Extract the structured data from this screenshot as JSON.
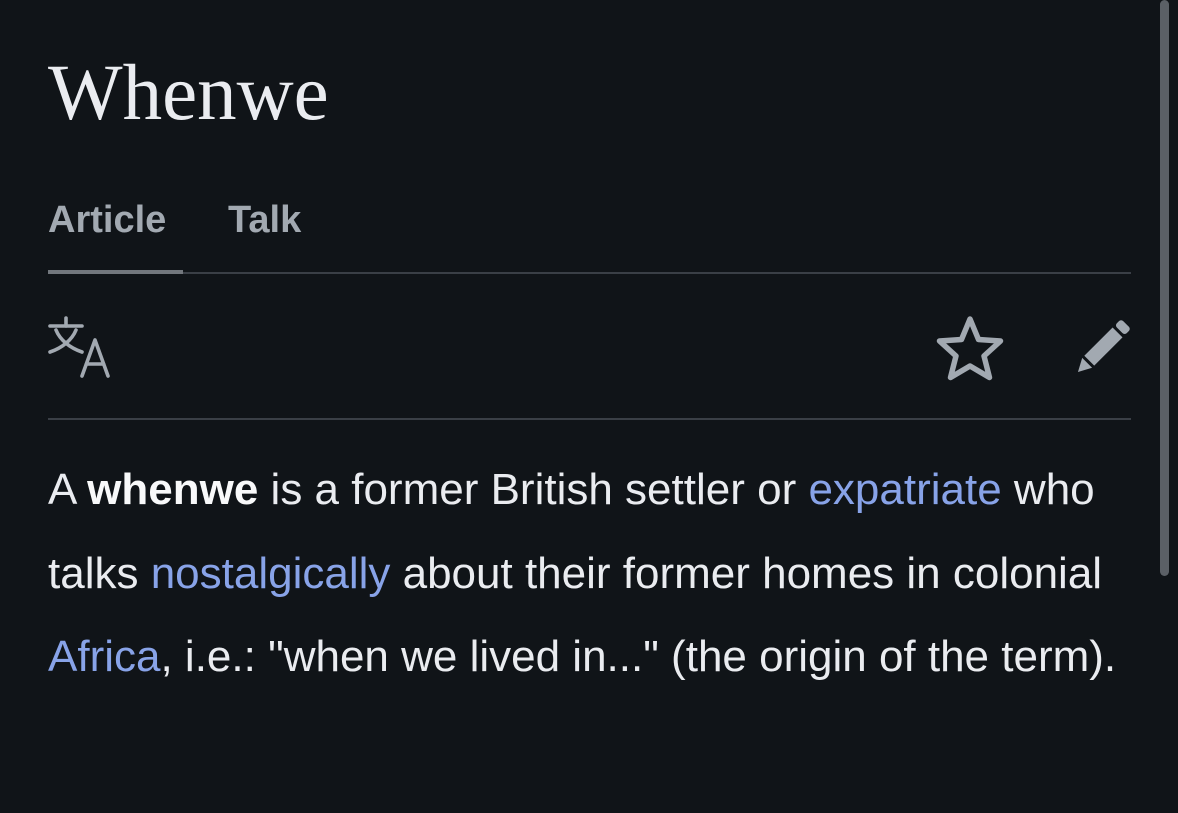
{
  "article": {
    "title": "Whenwe",
    "tabs": [
      {
        "label": "Article",
        "active": true
      },
      {
        "label": "Talk",
        "active": false
      }
    ],
    "toolbar": {
      "language_icon": "translate-icon",
      "watch_icon": "star-icon",
      "edit_icon": "pencil-icon"
    },
    "intro": {
      "t1": "A ",
      "bold": "whenwe",
      "t2": " is a former British settler or ",
      "link1": "expatriate",
      "t3": " who talks ",
      "link2": "nostalgically",
      "t4": " about their former homes in colonial ",
      "link3": "Africa",
      "t5": ", i.e.: \"when we lived in...\" (the origin of the term)."
    }
  },
  "colors": {
    "background": "#101418",
    "text": "#eaecf0",
    "muted": "#a2a9b1",
    "link": "#88a3e8",
    "divider": "#3a3f46"
  }
}
